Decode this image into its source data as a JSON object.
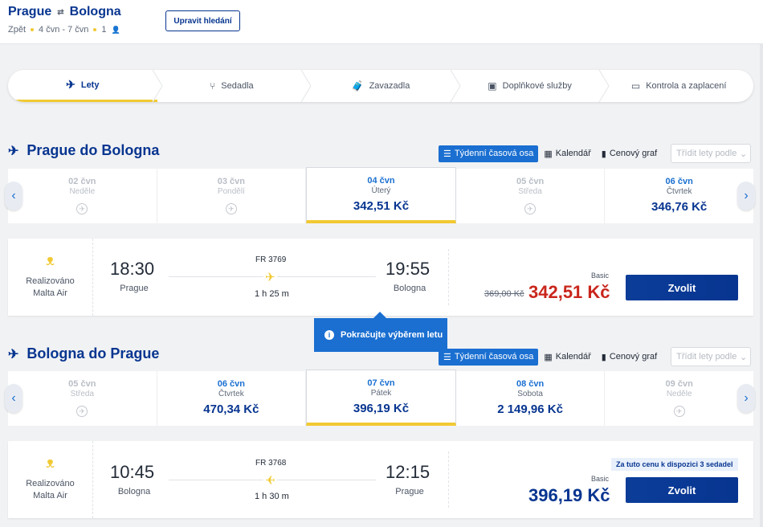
{
  "header": {
    "origin": "Prague",
    "destination": "Bologna",
    "trip_type": "Zpět",
    "dates": "4 čvn - 7 čvn",
    "passengers": "1",
    "edit_label": "Upravit hledání"
  },
  "steps": [
    {
      "label": "Lety",
      "icon": "plane-icon"
    },
    {
      "label": "Sedadla",
      "icon": "seat-icon"
    },
    {
      "label": "Zavazadla",
      "icon": "luggage-icon"
    },
    {
      "label": "Doplňkové služby",
      "icon": "bus-icon"
    },
    {
      "label": "Kontrola a zaplacení",
      "icon": "card-icon"
    }
  ],
  "view_controls": {
    "weekly": "Týdenní časová osa",
    "calendar": "Kalendář",
    "price_chart": "Cenový graf",
    "sort_placeholder": "Třídit lety podle"
  },
  "outbound": {
    "title": "Prague do Bologna",
    "dates": [
      {
        "date": "02 čvn",
        "day": "Neděle",
        "price": null
      },
      {
        "date": "03 čvn",
        "day": "Pondělí",
        "price": null
      },
      {
        "date": "04 čvn",
        "day": "Úterý",
        "price": "342,51 Kč",
        "selected": true
      },
      {
        "date": "05 čvn",
        "day": "Středa",
        "price": null
      },
      {
        "date": "06 čvn",
        "day": "Čtvrtek",
        "price": "346,76 Kč"
      }
    ],
    "flight": {
      "operator_line1": "Realizováno",
      "operator_line2": "Malta Air",
      "dep_time": "18:30",
      "dep_city": "Prague",
      "flight_no": "FR 3769",
      "duration": "1 h 25 m",
      "arr_time": "19:55",
      "arr_city": "Bologna",
      "fare": "Basic",
      "old_price": "369,00 Kč",
      "price": "342,51 Kč",
      "choose_label": "Zvolit"
    }
  },
  "tooltip": "Pokračujte výběrem letu",
  "inbound": {
    "title": "Bologna do Prague",
    "dates": [
      {
        "date": "05 čvn",
        "day": "Středa",
        "price": null
      },
      {
        "date": "06 čvn",
        "day": "Čtvrtek",
        "price": "470,34 Kč"
      },
      {
        "date": "07 čvn",
        "day": "Pátek",
        "price": "396,19 Kč",
        "selected": true
      },
      {
        "date": "08 čvn",
        "day": "Sobota",
        "price": "2 149,96 Kč"
      },
      {
        "date": "09 čvn",
        "day": "Neděle",
        "price": null
      }
    ],
    "flight": {
      "operator_line1": "Realizováno",
      "operator_line2": "Malta Air",
      "dep_time": "10:45",
      "dep_city": "Bologna",
      "flight_no": "FR 3768",
      "duration": "1 h 30 m",
      "arr_time": "12:15",
      "arr_city": "Prague",
      "seats_note": "Za tuto cenu k dispozici 3 sedadel",
      "fare": "Basic",
      "price": "396,19 Kč",
      "choose_label": "Zvolit"
    }
  },
  "colors": {
    "brand": "#073590",
    "accent": "#f1c933",
    "link": "#1a6fd1",
    "discount": "#c9261c"
  }
}
